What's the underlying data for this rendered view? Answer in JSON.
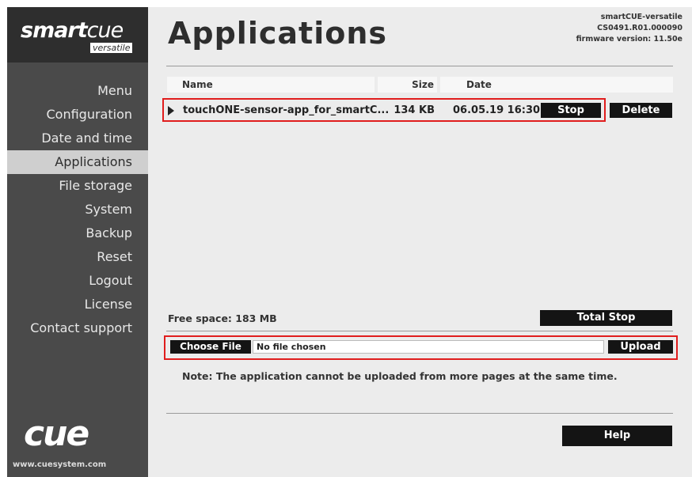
{
  "logo": {
    "smart_bold": "smart",
    "smart_light": "cue",
    "tagline": "versatile"
  },
  "menu": {
    "items": [
      {
        "label": "Menu",
        "active": false
      },
      {
        "label": "Configuration",
        "active": false
      },
      {
        "label": "Date and time",
        "active": false
      },
      {
        "label": "Applications",
        "active": true
      },
      {
        "label": "File storage",
        "active": false
      },
      {
        "label": "System",
        "active": false
      },
      {
        "label": "Backup",
        "active": false
      },
      {
        "label": "Reset",
        "active": false
      },
      {
        "label": "Logout",
        "active": false
      },
      {
        "label": "License",
        "active": false
      },
      {
        "label": "Contact support",
        "active": false
      }
    ]
  },
  "brand": {
    "logo_text": "cue",
    "url": "www.cuesystem.com"
  },
  "header": {
    "title": "Applications",
    "device_name": "smartCUE-versatile",
    "serial": "CS0491.R01.000090",
    "firmware": "firmware version: 11.50e"
  },
  "table": {
    "columns": [
      "Name",
      "Size",
      "Date"
    ],
    "rows": [
      {
        "name": "touchONE-sensor-app_for_smartC...",
        "size": "134 KB",
        "date": "06.05.19 16:30",
        "stop_label": "Stop",
        "delete_label": "Delete"
      }
    ]
  },
  "footer": {
    "free_space": "Free space: 183 MB",
    "total_stop_label": "Total Stop",
    "choose_file_label": "Choose File",
    "file_status": "No file chosen",
    "upload_label": "Upload",
    "note": "Note: The application cannot be uploaded from more pages at the same time.",
    "help_label": "Help"
  },
  "colors": {
    "sidebar_bg": "#4a4a4a",
    "logo_bg": "#2e2e2e",
    "main_bg": "#ececec",
    "active_menu_bg": "#cfcfcf",
    "button_bg": "#141414",
    "highlight_border": "#e01d1d"
  }
}
